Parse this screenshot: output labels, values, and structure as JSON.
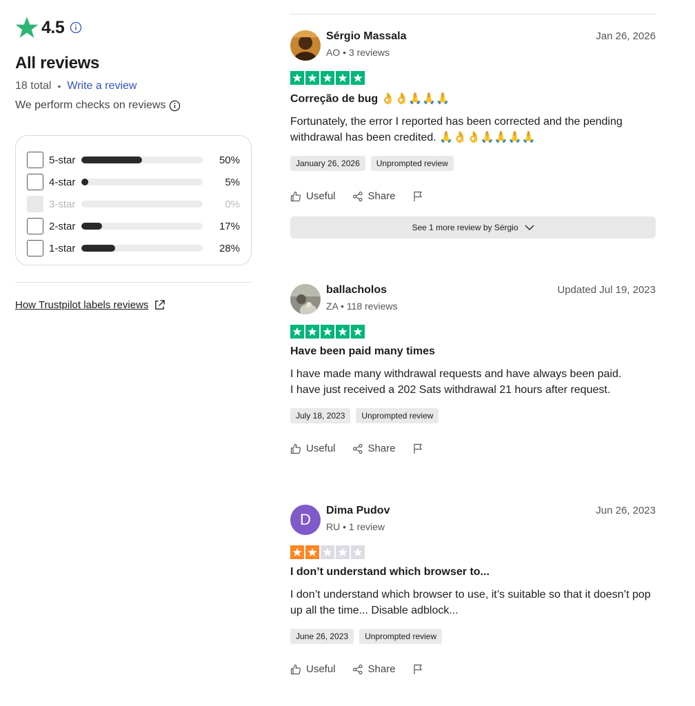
{
  "summary": {
    "rating": "4.5",
    "all_reviews_title": "All reviews",
    "total": "18 total",
    "write_review": "Write a review",
    "checks_text": "We perform checks on reviews",
    "labels_link": "How Trustpilot labels reviews"
  },
  "filters": [
    {
      "label": "5-star",
      "pct": "50%",
      "fill": 0.5,
      "disabled": false
    },
    {
      "label": "4-star",
      "pct": "5%",
      "fill": 0.05,
      "disabled": false
    },
    {
      "label": "3-star",
      "pct": "0%",
      "fill": 0.0,
      "disabled": true
    },
    {
      "label": "2-star",
      "pct": "17%",
      "fill": 0.17,
      "disabled": false
    },
    {
      "label": "1-star",
      "pct": "28%",
      "fill": 0.28,
      "disabled": false
    }
  ],
  "colors": {
    "star_green": "#00b67a",
    "star_orange": "#ff8622",
    "star_empty": "#dcdce6",
    "link_blue": "#3350c4"
  },
  "actions": {
    "useful": "Useful",
    "share": "Share"
  },
  "reviews": [
    {
      "name": "Sérgio Massala",
      "meta": "AO • 3 reviews",
      "date": "Jan 26, 2026",
      "stars": 5,
      "title": "Correção de bug 👌👌🙏🙏🙏",
      "body": "Fortunately, the error I reported has been corrected and the pending withdrawal has been credited. 🙏👌👌🙏🙏🙏🙏",
      "experience_date": "January 26, 2026",
      "label": "Unprompted review",
      "more": "See 1 more review by Sérgio"
    },
    {
      "name": "ballacholos",
      "meta": "ZA • 118 reviews",
      "date": "Updated Jul 19, 2023",
      "stars": 5,
      "title": "Have been paid many times",
      "body_line1": "I have made many withdrawal requests and have always been paid.",
      "body_line2": "I have just received a 202 Sats withdrawal 21 hours after request.",
      "experience_date": "July 18, 2023",
      "label": "Unprompted review"
    },
    {
      "name": "Dima Pudov",
      "initial": "D",
      "meta": "RU • 1 review",
      "date": "Jun 26, 2023",
      "stars": 2,
      "title": "I don’t understand which browser to...",
      "body": "I don’t understand which browser to use, it’s suitable so that it doesn’t pop up all the time... Disable adblock...",
      "experience_date": "June 26, 2023",
      "label": "Unprompted review"
    }
  ]
}
